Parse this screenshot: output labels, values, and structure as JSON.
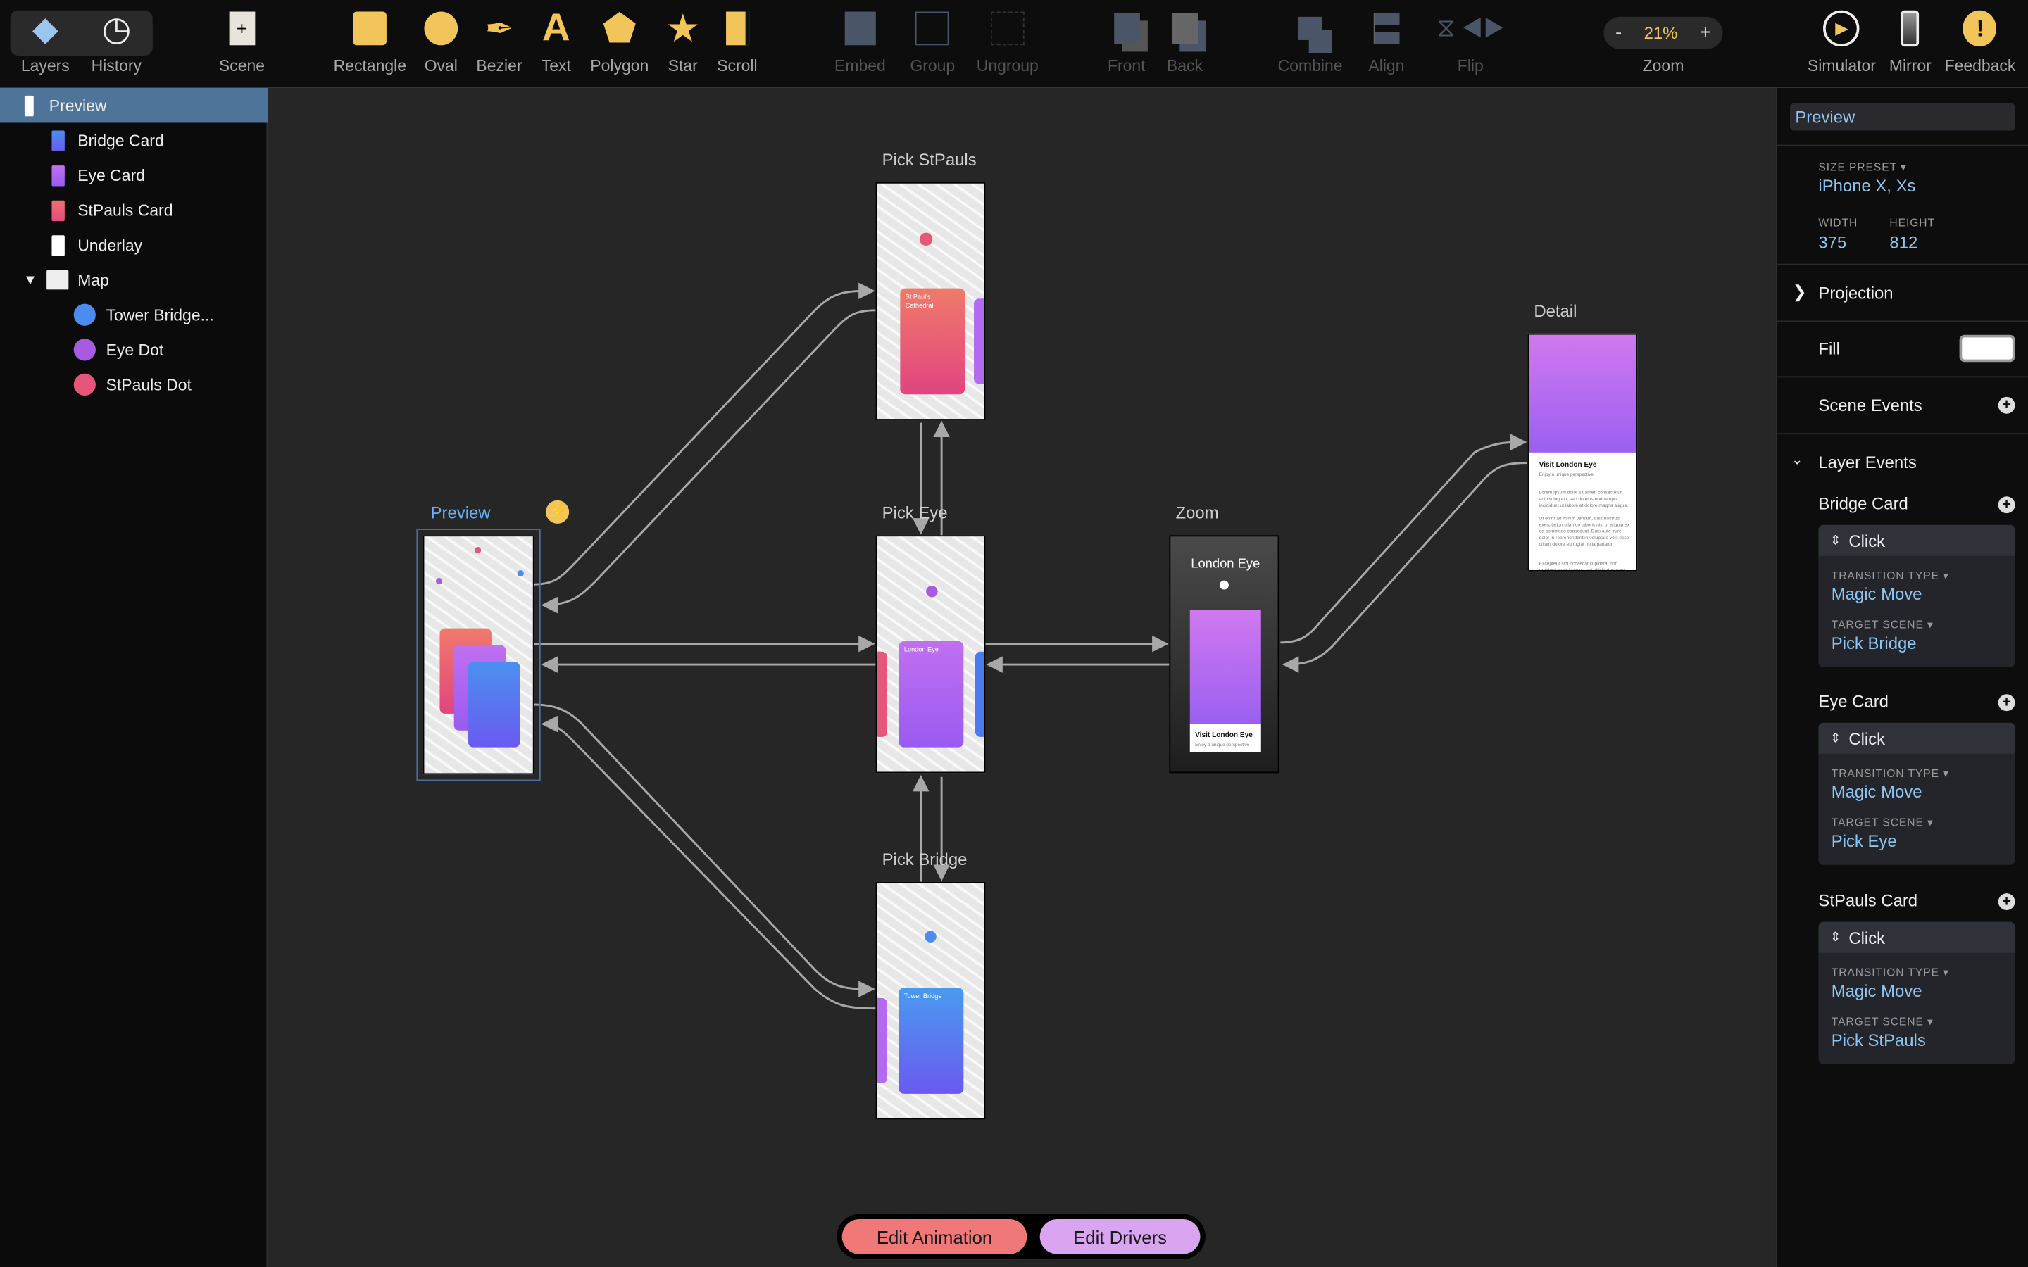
{
  "toolbar": {
    "layers": "Layers",
    "history": "History",
    "scene": "Scene",
    "rectangle": "Rectangle",
    "oval": "Oval",
    "bezier": "Bezier",
    "text": "Text",
    "polygon": "Polygon",
    "star": "Star",
    "scroll": "Scroll",
    "embed": "Embed",
    "group": "Group",
    "ungroup": "Ungroup",
    "front": "Front",
    "back": "Back",
    "combine": "Combine",
    "align": "Align",
    "flip": "Flip",
    "zoom_label": "Zoom",
    "zoom_value": "21%",
    "zoom_minus": "-",
    "zoom_plus": "+",
    "simulator": "Simulator",
    "mirror": "Mirror",
    "feedback": "Feedback",
    "accent": "#f2c55a"
  },
  "layers": [
    {
      "label": "Preview",
      "kind": "scene",
      "selected": true
    },
    {
      "label": "Bridge Card",
      "kind": "card",
      "color": "#4a7cf0"
    },
    {
      "label": "Eye Card",
      "kind": "card",
      "color": "#b46af0"
    },
    {
      "label": "StPauls Card",
      "kind": "card",
      "color": "#e85a7a"
    },
    {
      "label": "Underlay",
      "kind": "rect",
      "color": "#ffffff"
    },
    {
      "label": "Map",
      "kind": "group",
      "expanded": true
    },
    {
      "label": "Tower Bridge...",
      "kind": "dot",
      "color": "#4a8cf0"
    },
    {
      "label": "Eye Dot",
      "kind": "dot",
      "color": "#a85ae0"
    },
    {
      "label": "StPauls Dot",
      "kind": "dot",
      "color": "#e8557a"
    }
  ],
  "canvas": {
    "scenes": {
      "pick_stpauls": {
        "label": "Pick StPauls",
        "card_text": "St Paul's Cathedral"
      },
      "preview": {
        "label": "Preview"
      },
      "pick_eye": {
        "label": "Pick Eye",
        "card_text": "London Eye"
      },
      "zoom": {
        "label": "Zoom",
        "title": "London Eye",
        "card_title": "Visit London Eye",
        "card_sub": "Enjoy a unique perspective"
      },
      "detail": {
        "label": "Detail",
        "title": "Visit London Eye",
        "sub": "Enjoy a unique perspective",
        "p1": "Lorem ipsum dolor sit amet, consectetur adipiscing elit, sed do eiusmod tempor incididunt ut labore et dolore magna aliqua.",
        "p2": "Ut enim ad minim veniam, quis nostrud exercitation ullamco laboris nisi ut aliquip ex ea commodo consequat. Duis aute irure dolor in reprehenderit in voluptate velit esse cillum dolore eu fugiat nulla pariatur.",
        "p3": "Excepteur sint occaecat cupidatat non proident, sunt in culpa qui officia deserunt"
      },
      "pick_bridge": {
        "label": "Pick Bridge",
        "card_text": "Tower Bridge"
      }
    },
    "edit_animation": "Edit Animation",
    "edit_drivers": "Edit Drivers"
  },
  "inspector": {
    "name": "Preview",
    "size_preset_label": "SIZE PRESET",
    "size_preset": "iPhone X, Xs",
    "width_label": "WIDTH",
    "width": "375",
    "height_label": "HEIGHT",
    "height": "812",
    "projection": "Projection",
    "fill": "Fill",
    "fill_color": "#ffffff",
    "scene_events": "Scene Events",
    "layer_events": "Layer Events",
    "events": [
      {
        "layer": "Bridge Card",
        "trigger": "Click",
        "tt_label": "TRANSITION TYPE",
        "tt": "Magic Move",
        "ts_label": "TARGET SCENE",
        "ts": "Pick Bridge"
      },
      {
        "layer": "Eye Card",
        "trigger": "Click",
        "tt_label": "TRANSITION TYPE",
        "tt": "Magic Move",
        "ts_label": "TARGET SCENE",
        "ts": "Pick Eye"
      },
      {
        "layer": "StPauls Card",
        "trigger": "Click",
        "tt_label": "TRANSITION TYPE",
        "tt": "Magic Move",
        "ts_label": "TARGET SCENE",
        "ts": "Pick StPauls"
      }
    ]
  }
}
